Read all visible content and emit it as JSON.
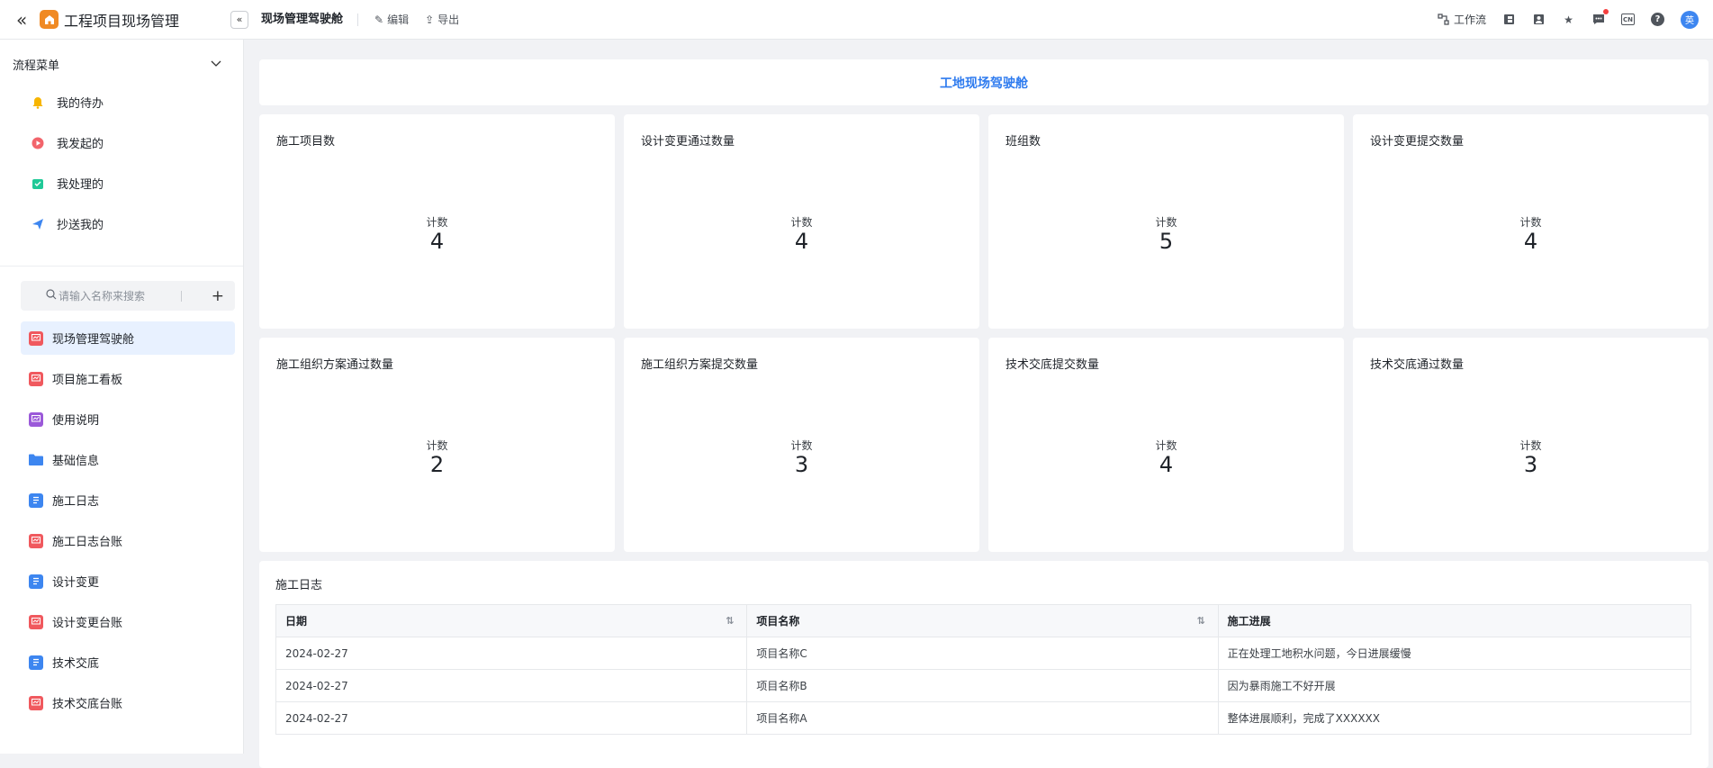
{
  "header": {
    "app_title": "工程项目现场管理",
    "page_name": "现场管理驾驶舱",
    "actions": [
      {
        "icon": "edit-icon",
        "label": "编辑"
      },
      {
        "icon": "export-icon",
        "label": "导出"
      }
    ],
    "workflow_label": "工作流",
    "language": "CN",
    "avatar_text": "英"
  },
  "sidebar": {
    "flow_menu_label": "流程菜单",
    "flow_items": [
      {
        "label": "我的待办",
        "icon": "bell-icon",
        "color": "#f7b500"
      },
      {
        "label": "我发起的",
        "icon": "play-icon",
        "color": "#f2646b"
      },
      {
        "label": "我处理的",
        "icon": "processed-icon",
        "color": "#20c997"
      },
      {
        "label": "抄送我的",
        "icon": "send-icon",
        "color": "#3d86f0"
      }
    ],
    "search_placeholder": "请输入名称来搜索",
    "nav_items": [
      {
        "label": "现场管理驾驶舱",
        "icon": "dashboard-icon",
        "color": "#f0595e",
        "active": true
      },
      {
        "label": "项目施工看板",
        "icon": "dashboard-icon",
        "color": "#f0595e"
      },
      {
        "label": "使用说明",
        "icon": "dashboard-icon",
        "color": "#9b59d9"
      },
      {
        "label": "基础信息",
        "icon": "folder-icon",
        "color": "#3d86f0"
      },
      {
        "label": "施工日志",
        "icon": "form-icon",
        "color": "#3d86f0"
      },
      {
        "label": "施工日志台账",
        "icon": "dashboard-icon",
        "color": "#f0595e"
      },
      {
        "label": "设计变更",
        "icon": "form-icon",
        "color": "#3d86f0"
      },
      {
        "label": "设计变更台账",
        "icon": "dashboard-icon",
        "color": "#f0595e"
      },
      {
        "label": "技术交底",
        "icon": "form-icon",
        "color": "#3d86f0"
      },
      {
        "label": "技术交底台账",
        "icon": "dashboard-icon",
        "color": "#f0595e"
      }
    ]
  },
  "main": {
    "title": "工地现场驾驶舱",
    "stats": [
      {
        "title": "施工项目数",
        "label": "计数",
        "value": "4"
      },
      {
        "title": "设计变更通过数量",
        "label": "计数",
        "value": "4"
      },
      {
        "title": "班组数",
        "label": "计数",
        "value": "5"
      },
      {
        "title": "设计变更提交数量",
        "label": "计数",
        "value": "4"
      },
      {
        "title": "施工组织方案通过数量",
        "label": "计数",
        "value": "2"
      },
      {
        "title": "施工组织方案提交数量",
        "label": "计数",
        "value": "3"
      },
      {
        "title": "技术交底提交数量",
        "label": "计数",
        "value": "4"
      },
      {
        "title": "技术交底通过数量",
        "label": "计数",
        "value": "3"
      }
    ],
    "log": {
      "title": "施工日志",
      "columns": [
        "日期",
        "项目名称",
        "施工进展"
      ],
      "rows": [
        [
          "2024-02-27",
          "项目名称C",
          "正在处理工地积水问题，今日进展缓慢"
        ],
        [
          "2024-02-27",
          "项目名称B",
          "因为暴雨施工不好开展"
        ],
        [
          "2024-02-27",
          "项目名称A",
          "整体进展顺利，完成了XXXXXX"
        ]
      ]
    }
  }
}
